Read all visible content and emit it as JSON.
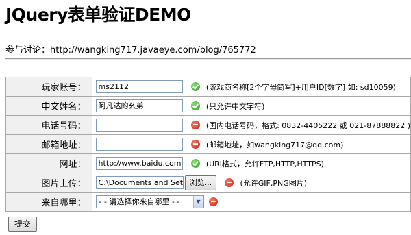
{
  "title": "JQuery表单验证DEMO",
  "discuss": "参与讨论：http://wangking717.javaeye.com/blog/765772",
  "fields": {
    "account": {
      "label": "玩家账号：",
      "value": "ms2112",
      "status": "ok",
      "hint": "(游戏商名称[2个字母简写]+用户ID[数字] 如: sd10059)"
    },
    "name": {
      "label": "中文姓名：",
      "value": "阿凡达的幺弟",
      "status": "ok",
      "hint": "(只允许中文字符)"
    },
    "phone": {
      "label": "电话号码：",
      "value": "",
      "status": "error",
      "hint": "(国内电话号码，格式: 0832-4405222 或 021-87888822 )"
    },
    "email": {
      "label": "邮箱地址：",
      "value": "",
      "status": "error",
      "hint": "(邮箱地址，如wangking717@qq.com)"
    },
    "url": {
      "label": "网址：",
      "value": "http://www.baidu.com",
      "status": "ok",
      "hint": "(URl格式，允许FTP,HTTP,HTTPS)"
    },
    "image": {
      "label": "图片上传：",
      "value": "C:\\Documents and Setti",
      "browse": "浏览...",
      "status": "error",
      "hint": "(允许GIF,PNG图片)"
    },
    "origin": {
      "label": "来自哪里：",
      "selected": "- - 请选择你来自哪里 - -",
      "status": "error"
    }
  },
  "submit": "提交",
  "icons": {
    "ok": "check-circle-icon",
    "error": "minus-circle-icon"
  },
  "colors": {
    "ok": "#2f9a22",
    "error": "#c81e0c",
    "label_bg": "#f0f0f0"
  }
}
